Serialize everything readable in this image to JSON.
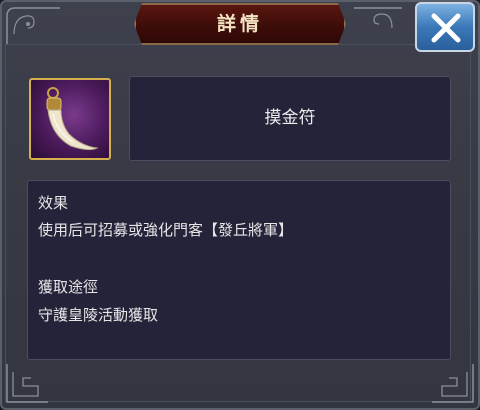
{
  "dialog": {
    "title": "詳情",
    "close_icon": "close-x-icon"
  },
  "item": {
    "icon": "tooth-amulet-icon",
    "name": "摸金符"
  },
  "details": {
    "effect_heading": "效果",
    "effect_text": "使用后可招募或強化門客【發丘將軍】",
    "source_heading": "獲取途徑",
    "source_text": "守護皇陵活動獲取"
  },
  "colors": {
    "title_plate": "#4a120c",
    "close_button": "#3b78b8",
    "item_frame_border": "#d6b04e",
    "content_box": "#25233a"
  }
}
